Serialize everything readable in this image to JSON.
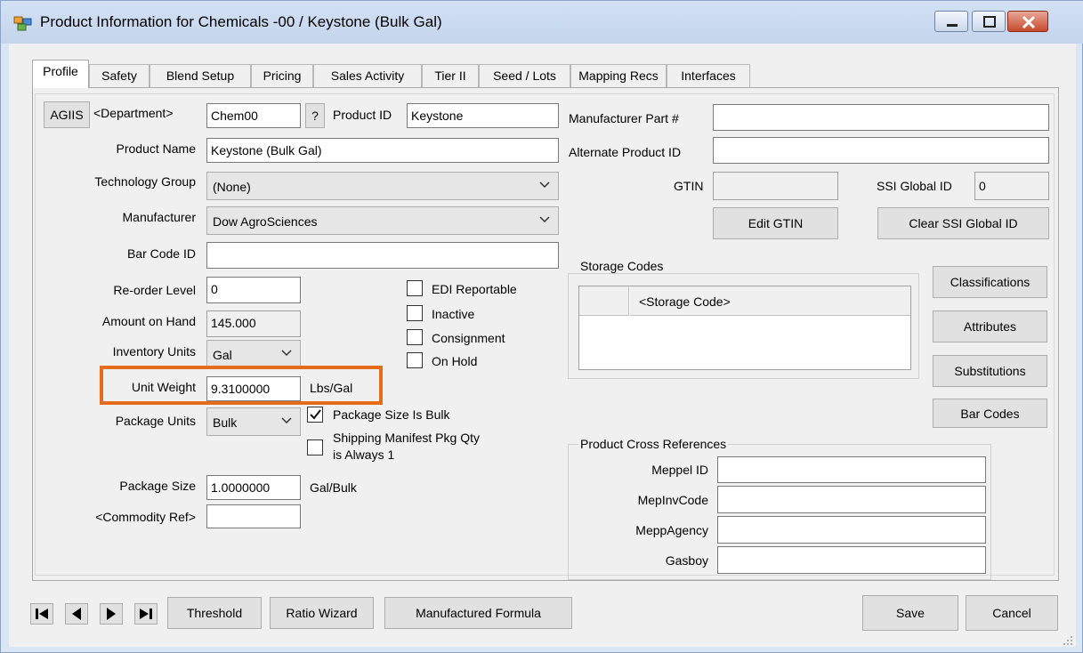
{
  "window": {
    "title": "Product Information for Chemicals -00 / Keystone (Bulk Gal)"
  },
  "tabs": [
    "Profile",
    "Safety",
    "Blend Setup",
    "Pricing",
    "Sales Activity",
    "Tier II",
    "Seed / Lots",
    "Mapping Recs",
    "Interfaces"
  ],
  "active_tab": "Profile",
  "left": {
    "agiis_label": "AGIIS",
    "department_label": "<Department>",
    "department_value": "Chem00",
    "question_label": "?",
    "product_id_label": "Product ID",
    "product_id_value": "Keystone",
    "product_name_label": "Product Name",
    "product_name_value": "Keystone (Bulk Gal)",
    "technology_group_label": "Technology Group",
    "technology_group_value": "(None)",
    "manufacturer_label": "Manufacturer",
    "manufacturer_value": "Dow AgroSciences",
    "bar_code_label": "Bar Code ID",
    "bar_code_value": "",
    "reorder_label": "Re-order Level",
    "reorder_value": "0",
    "amount_label": "Amount on Hand",
    "amount_value": "145.000",
    "inventory_units_label": "Inventory Units",
    "inventory_units_value": "Gal",
    "unit_weight_label": "Unit Weight",
    "unit_weight_value": "9.3100000",
    "unit_weight_units": "Lbs/Gal",
    "package_units_label": "Package Units",
    "package_units_value": "Bulk",
    "package_size_label": "Package Size",
    "package_size_value": "1.0000000",
    "package_size_units": "Gal/Bulk",
    "commodity_label": "<Commodity Ref>",
    "commodity_value": ""
  },
  "checkboxes": {
    "edi": {
      "label": "EDI Reportable",
      "checked": false
    },
    "inactive": {
      "label": "Inactive",
      "checked": false
    },
    "consignment": {
      "label": "Consignment",
      "checked": false
    },
    "on_hold": {
      "label": "On Hold",
      "checked": false
    },
    "package_bulk": {
      "label": "Package Size Is Bulk",
      "checked": true
    },
    "shipping_line1": "Shipping Manifest Pkg Qty",
    "shipping_line2": "is Always 1",
    "shipping_checked": false
  },
  "right": {
    "manufacturer_part_label": "Manufacturer Part #",
    "manufacturer_part_value": "",
    "alternate_id_label": "Alternate Product ID",
    "alternate_id_value": "",
    "gtin_label": "GTIN",
    "gtin_value": "",
    "ssi_label": "SSI Global ID",
    "ssi_value": "0",
    "edit_gtin_label": "Edit GTIN",
    "clear_ssi_label": "Clear SSI Global ID",
    "storage_codes_title": "Storage Codes",
    "storage_code_header": "<Storage Code>",
    "classifications_label": "Classifications",
    "attributes_label": "Attributes",
    "substitutions_label": "Substitutions",
    "bar_codes_label": "Bar Codes",
    "cross_ref_title": "Product Cross References",
    "cross_refs": [
      {
        "label": "Meppel ID",
        "value": ""
      },
      {
        "label": "MepInvCode",
        "value": ""
      },
      {
        "label": "MeppAgency",
        "value": ""
      },
      {
        "label": "Gasboy",
        "value": ""
      }
    ]
  },
  "footer": {
    "threshold_label": "Threshold",
    "ratio_wizard_label": "Ratio Wizard",
    "manufactured_formula_label": "Manufactured Formula",
    "save_label": "Save",
    "cancel_label": "Cancel"
  },
  "colors": {
    "highlight": "#e46c1b",
    "close_button": "#c74a2e"
  }
}
